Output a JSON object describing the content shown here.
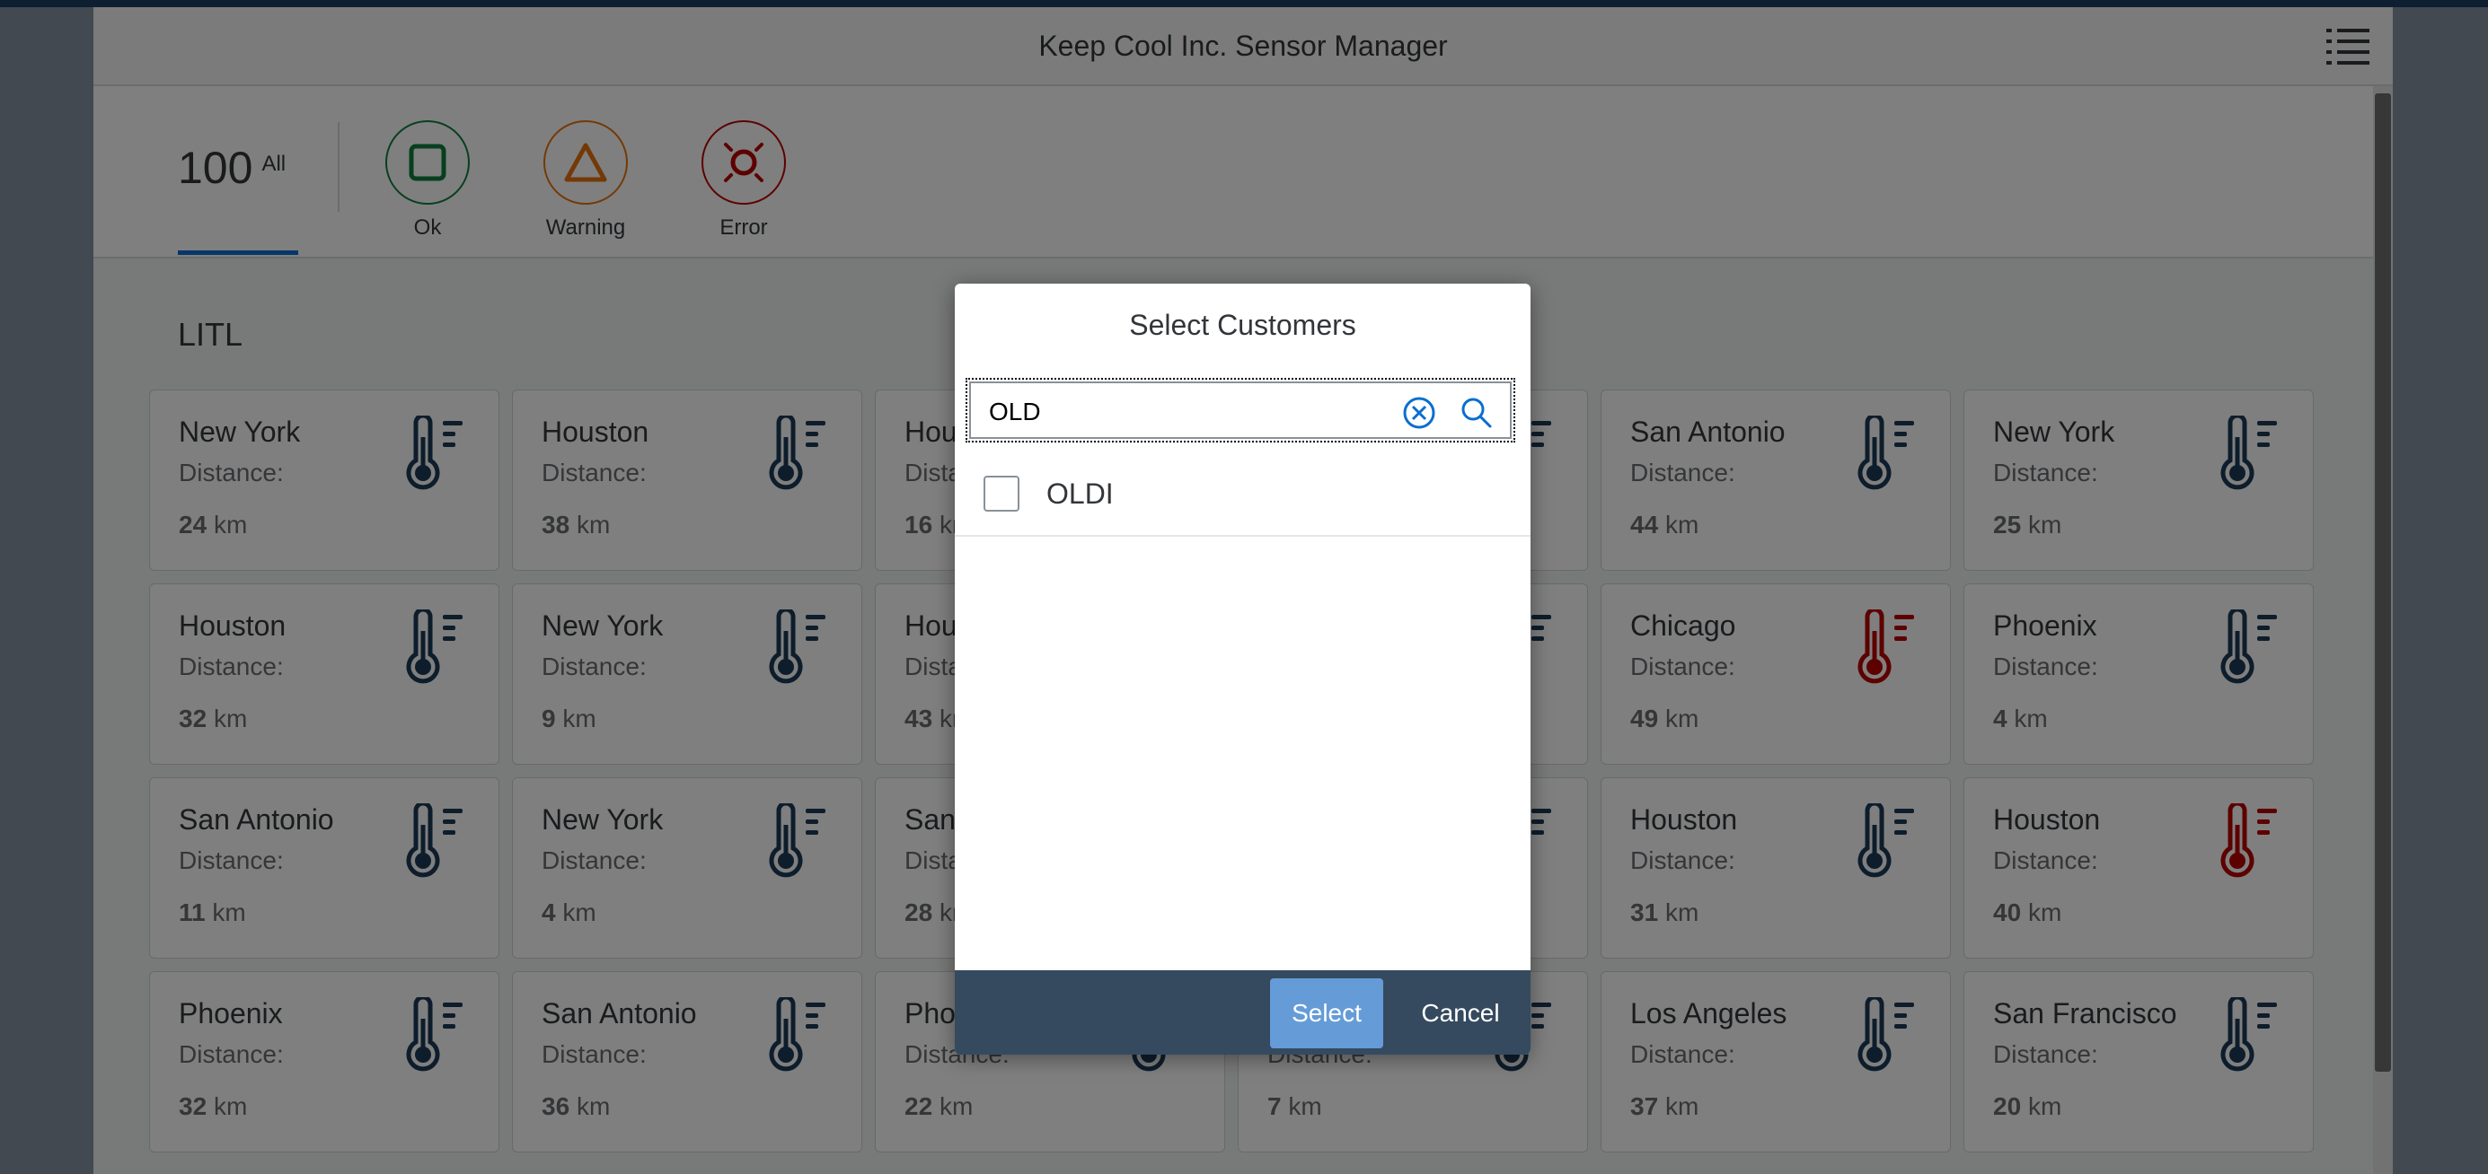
{
  "app": {
    "title": "Keep Cool Inc. Sensor Manager"
  },
  "filters": {
    "count": "100",
    "count_label": "All",
    "items": [
      {
        "label": "Ok",
        "icon": "ok-square-icon",
        "color": "#107e3e"
      },
      {
        "label": "Warning",
        "icon": "warning-triangle-icon",
        "color": "#e9730c"
      },
      {
        "label": "Error",
        "icon": "error-sun-icon",
        "color": "#bb0000"
      }
    ]
  },
  "section": {
    "title": "LITL"
  },
  "colors": {
    "icon_normal": "#1d3a57",
    "icon_alert": "#bb0000",
    "accent": "#0a6ed1"
  },
  "tiles": [
    {
      "city": "New York",
      "distance_label": "Distance:",
      "distance": "24",
      "unit": "km",
      "status": "normal"
    },
    {
      "city": "Houston",
      "distance_label": "Distance:",
      "distance": "38",
      "unit": "km",
      "status": "normal"
    },
    {
      "city": "Hou",
      "distance_label": "Distance:",
      "distance": "16",
      "unit": "km",
      "status": "normal"
    },
    {
      "city": "",
      "distance_label": "",
      "distance": "",
      "unit": "",
      "status": "normal"
    },
    {
      "city": "San Antonio",
      "distance_label": "Distance:",
      "distance": "44",
      "unit": "km",
      "status": "normal"
    },
    {
      "city": "New York",
      "distance_label": "Distance:",
      "distance": "25",
      "unit": "km",
      "status": "normal"
    },
    {
      "city": "Houston",
      "distance_label": "Distance:",
      "distance": "32",
      "unit": "km",
      "status": "normal"
    },
    {
      "city": "New York",
      "distance_label": "Distance:",
      "distance": "9",
      "unit": "km",
      "status": "normal"
    },
    {
      "city": "Hou",
      "distance_label": "Dista",
      "distance": "43",
      "unit": "km",
      "status": "normal"
    },
    {
      "city": "",
      "distance_label": "",
      "distance": "",
      "unit": "",
      "status": "normal"
    },
    {
      "city": "Chicago",
      "distance_label": "Distance:",
      "distance": "49",
      "unit": "km",
      "status": "alert"
    },
    {
      "city": "Phoenix",
      "distance_label": "Distance:",
      "distance": "4",
      "unit": "km",
      "status": "normal"
    },
    {
      "city": "San Antonio",
      "distance_label": "Distance:",
      "distance": "11",
      "unit": "km",
      "status": "normal"
    },
    {
      "city": "New York",
      "distance_label": "Distance:",
      "distance": "4",
      "unit": "km",
      "status": "normal"
    },
    {
      "city": "San",
      "distance_label": "Dista",
      "distance": "28",
      "unit": "km",
      "status": "normal"
    },
    {
      "city": "",
      "distance_label": "",
      "distance": "",
      "unit": "",
      "status": "normal"
    },
    {
      "city": "Houston",
      "distance_label": "Distance:",
      "distance": "31",
      "unit": "km",
      "status": "normal"
    },
    {
      "city": "Houston",
      "distance_label": "Distance:",
      "distance": "40",
      "unit": "km",
      "status": "alert"
    },
    {
      "city": "Phoenix",
      "distance_label": "Distance:",
      "distance": "32",
      "unit": "km",
      "status": "normal"
    },
    {
      "city": "San Antonio",
      "distance_label": "Distance:",
      "distance": "36",
      "unit": "km",
      "status": "normal"
    },
    {
      "city": "Pho",
      "distance_label": "Distance:",
      "distance": "22",
      "unit": "km",
      "status": "normal"
    },
    {
      "city": "",
      "distance_label": "Distance:",
      "distance": "7",
      "unit": "km",
      "status": "normal"
    },
    {
      "city": "Los Angeles",
      "distance_label": "Distance:",
      "distance": "37",
      "unit": "km",
      "status": "normal"
    },
    {
      "city": "San Francisco",
      "distance_label": "Distance:",
      "distance": "20",
      "unit": "km",
      "status": "normal"
    }
  ],
  "dialog": {
    "title": "Select Customers",
    "search_value": "OLD",
    "items": [
      {
        "label": "OLDI",
        "checked": false
      }
    ],
    "select_label": "Select",
    "cancel_label": "Cancel"
  }
}
